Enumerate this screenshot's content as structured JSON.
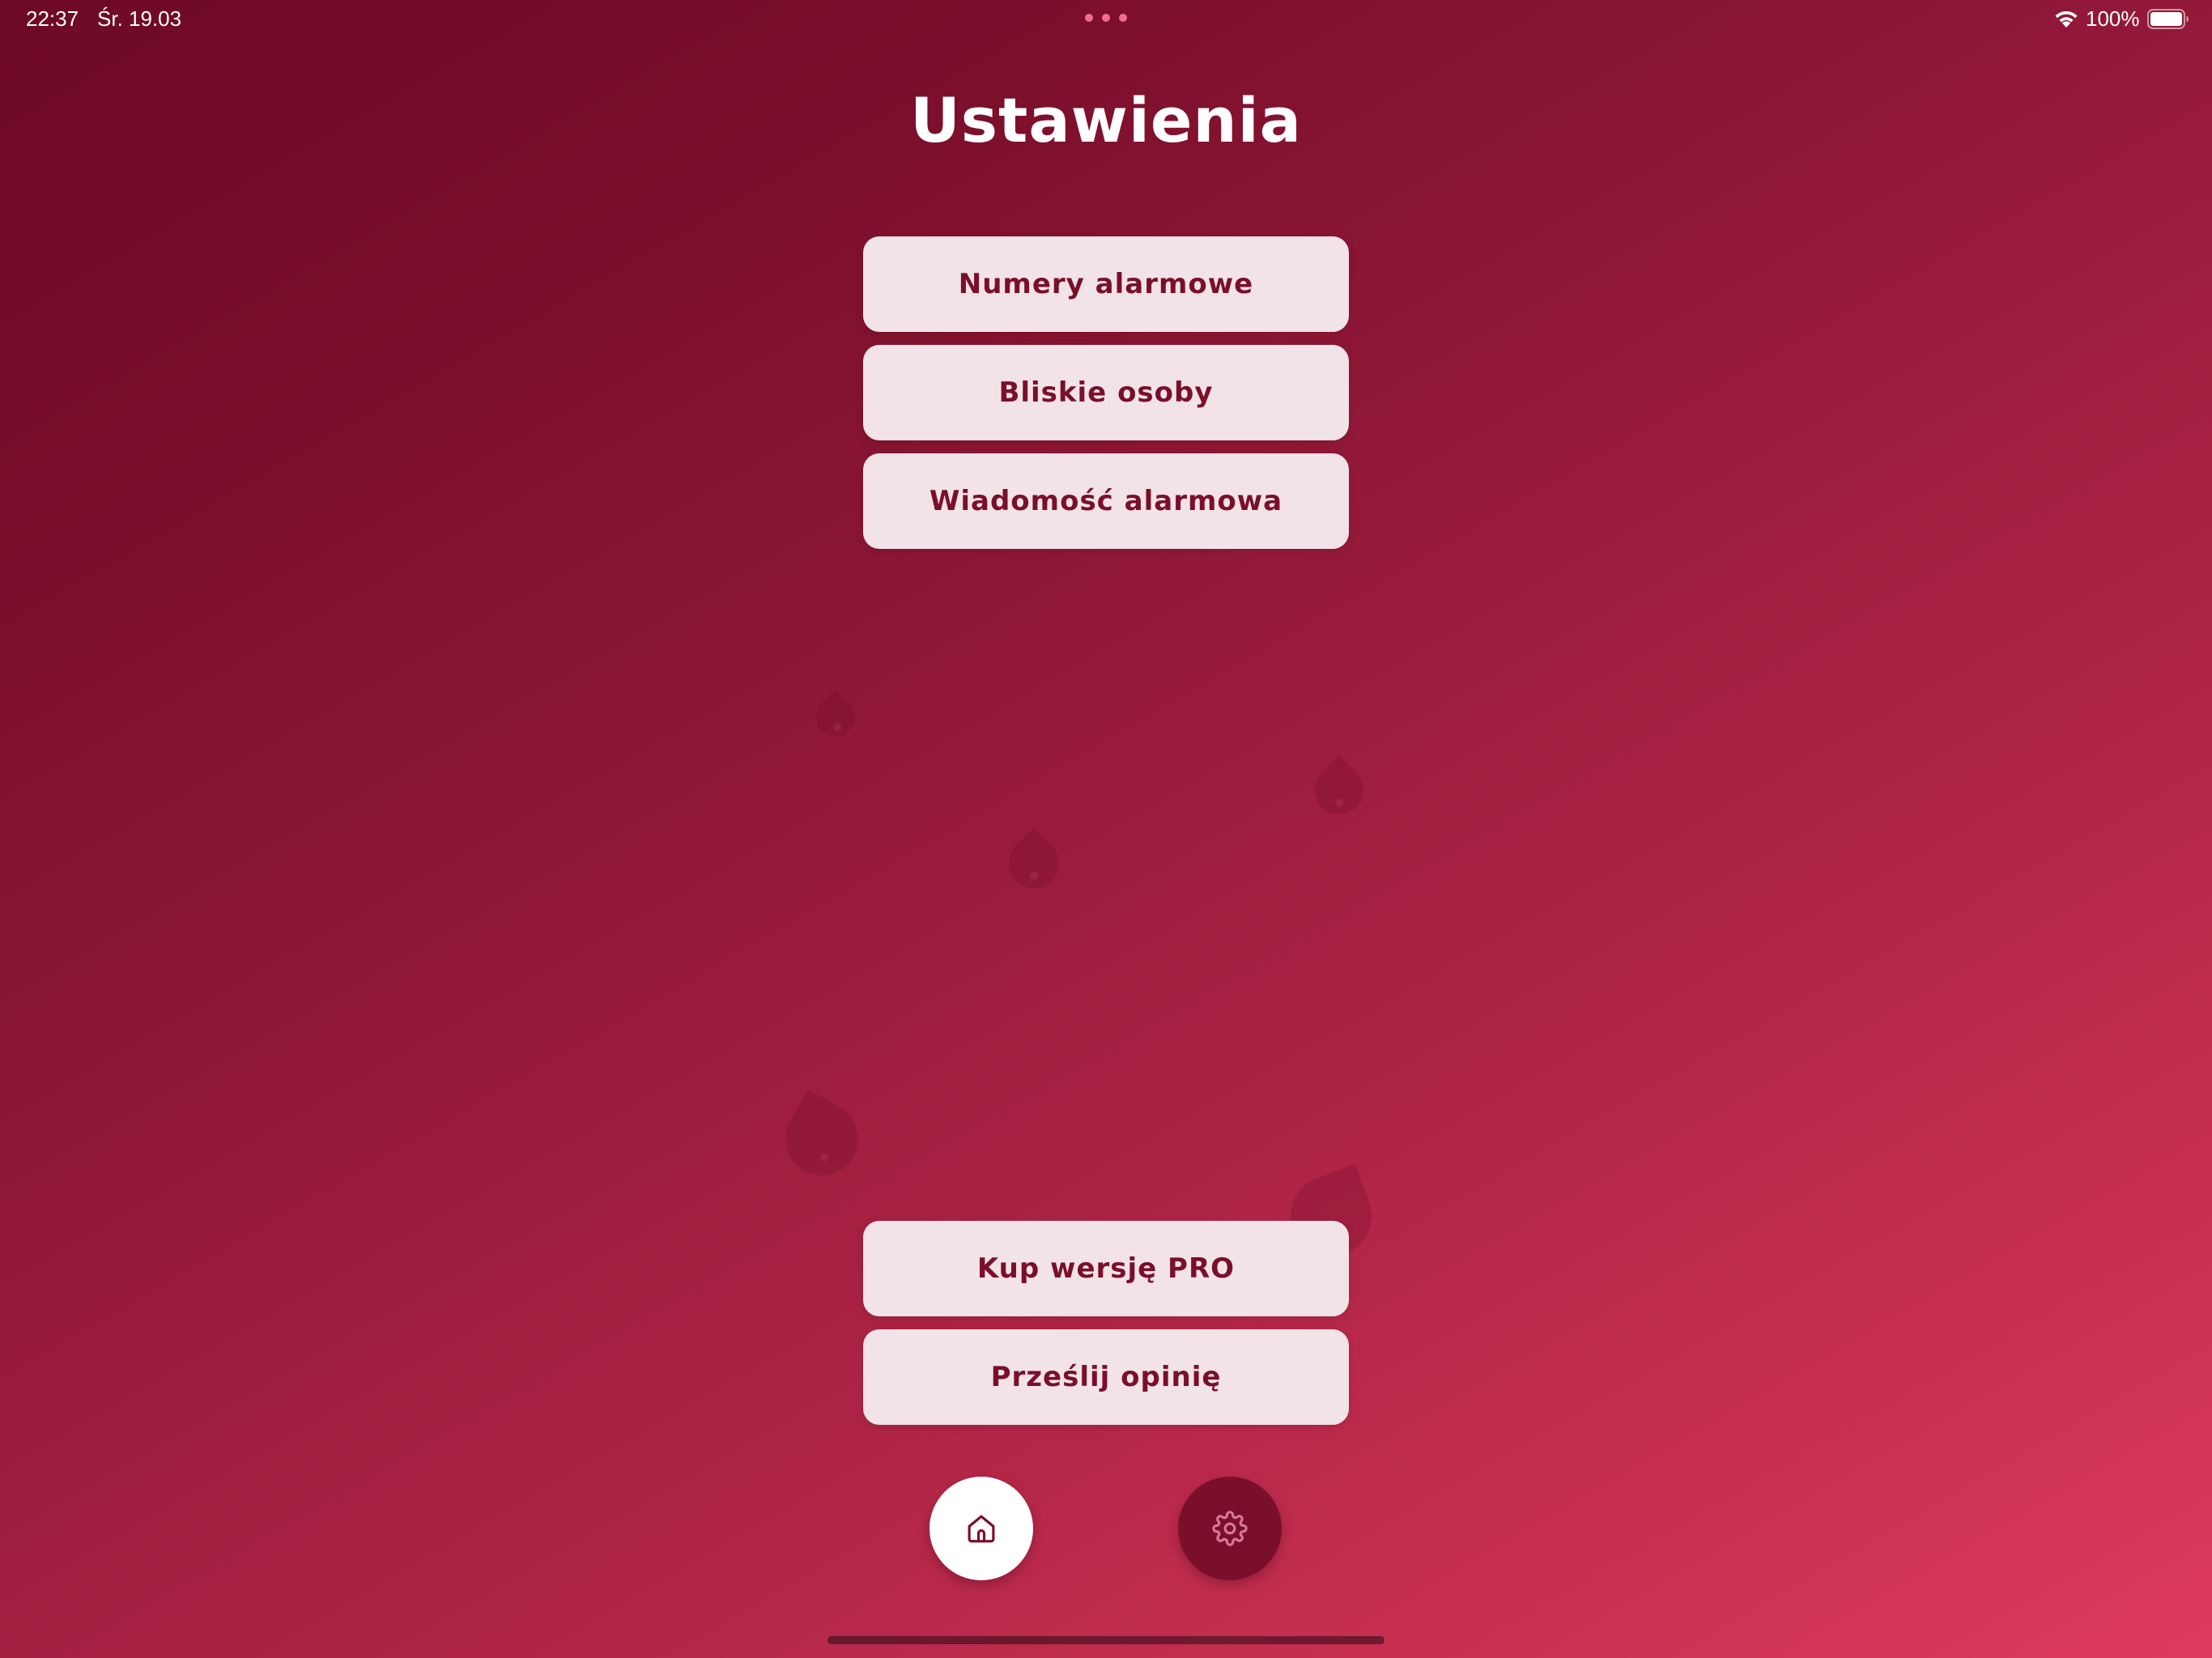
{
  "status_bar": {
    "time": "22:37",
    "date": "Śr. 19.03",
    "battery": "100%",
    "icons": [
      "multitask-dots-icon",
      "wifi-icon",
      "battery-icon"
    ]
  },
  "title": "Ustawienia",
  "menu": {
    "items": [
      {
        "label": "Numery alarmowe"
      },
      {
        "label": "Bliskie osoby"
      },
      {
        "label": "Wiadomość alarmowa"
      }
    ]
  },
  "bottom_actions": {
    "items": [
      {
        "label": "Kup wersję PRO"
      },
      {
        "label": "Prześlij opinię"
      }
    ]
  },
  "nav": {
    "home_icon": "home-icon",
    "settings_icon": "gear-icon",
    "active": "settings"
  },
  "colors": {
    "background_start": "#6e0a26",
    "background_end": "#dd3a5c",
    "button_bg": "#f1e3e7",
    "button_text": "#7a0f2c",
    "active_nav_bg": "#7a0f2c"
  }
}
